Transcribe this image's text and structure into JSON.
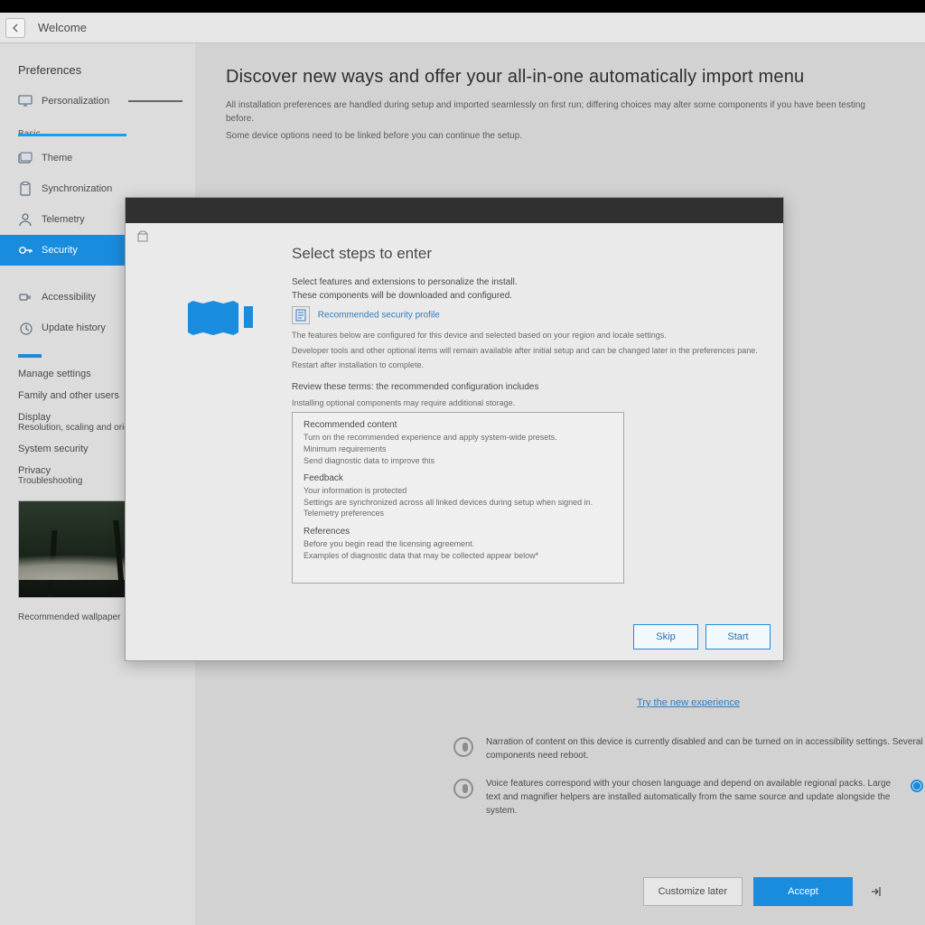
{
  "header": {
    "title": "Welcome"
  },
  "sidebar": {
    "section_title": "Preferences",
    "items": [
      {
        "label": "Personalization",
        "icon": "monitor"
      },
      {
        "label": "Theme",
        "icon": "palette",
        "sub": "Basic"
      },
      {
        "label": "Synchronization",
        "icon": "clipboard"
      },
      {
        "label": "Telemetry",
        "icon": "user"
      },
      {
        "label": "Security",
        "icon": "key",
        "active": true
      },
      {
        "label": "Accessibility",
        "icon": "plug"
      },
      {
        "label": "Update history",
        "icon": "history"
      }
    ],
    "groups": [
      {
        "title": "Manage settings"
      },
      {
        "title": "Family and other users"
      },
      {
        "title": "Display",
        "detail": "Resolution, scaling and orientation"
      },
      {
        "title": "System security"
      },
      {
        "title": "Privacy",
        "detail": "Troubleshooting"
      }
    ],
    "thumb_caption": "Recommended wallpaper"
  },
  "main": {
    "headline": "Discover new ways and offer your all-in-one automatically import menu",
    "p1": "All installation preferences are handled during setup and imported seamlessly on first run; differing choices may alter some components if you have been testing before.",
    "p2": "Some device options need to be linked before you can continue the setup.",
    "mid_link": "Try the new experience",
    "voice1": "Narration of content on this device is currently disabled and can be turned on in accessibility settings. Several components need reboot.",
    "voice2": "Voice features correspond with your chosen language and depend on available regional packs. Large text and magnifier helpers are installed automatically from the same source and update alongside the system.",
    "footer": {
      "secondary": "Customize later",
      "primary": "Accept"
    }
  },
  "dialog": {
    "title": "Select steps to enter",
    "intro1": "Select features and extensions to personalize the install.",
    "intro2": "These components will be downloaded and configured.",
    "highlight": "Recommended security profile",
    "desc1": "The features below are configured for this device and selected based on your region and locale settings.",
    "desc2": "Developer tools and other optional items will remain available after initial setup and can be changed later in the preferences pane.",
    "desc3": "Restart after installation to complete.",
    "sec2_title": "Review these terms: the recommended configuration includes",
    "sec2_sub": "Installing optional components may require additional storage.",
    "listbox": {
      "groups": [
        {
          "heading": "Recommended content",
          "items": [
            "Turn on the recommended experience and apply system-wide presets.",
            "Minimum requirements",
            "Send diagnostic data to improve this"
          ]
        },
        {
          "heading": "Feedback",
          "items": [
            "Your information is protected",
            "Settings are synchronized across all linked devices during setup when signed in.",
            "Telemetry preferences"
          ]
        },
        {
          "heading": "References",
          "items": [
            "Before you begin read the licensing agreement.",
            "Examples of diagnostic data that may be collected appear below*"
          ]
        }
      ]
    },
    "buttons": {
      "skip": "Skip",
      "start": "Start"
    }
  }
}
